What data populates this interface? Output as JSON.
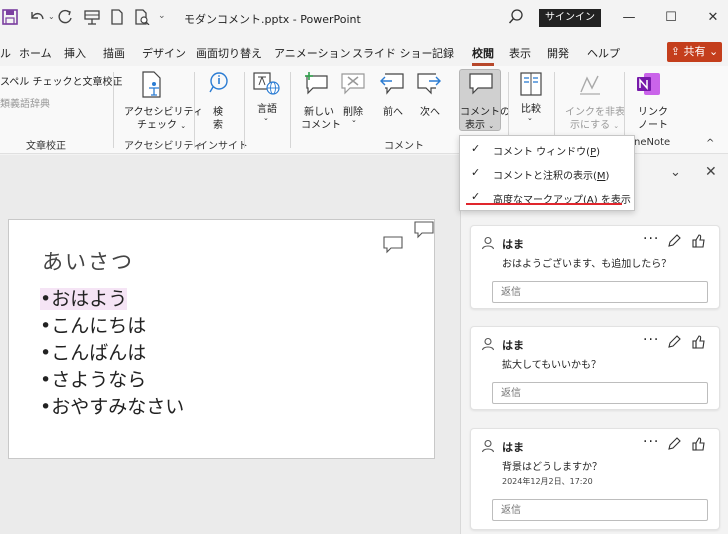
{
  "titlebar": {
    "title": "モダンコメント.pptx  -  PowerPoint",
    "signin_label": "サインイン",
    "minimize": "—",
    "maximize": "☐",
    "close": "✕",
    "undo_arrow": "⌄",
    "more": "⌄"
  },
  "tabs": [
    {
      "label": "ル"
    },
    {
      "label": "ホーム"
    },
    {
      "label": "挿入"
    },
    {
      "label": "描画"
    },
    {
      "label": "デザイン"
    },
    {
      "label": "画面切り替え"
    },
    {
      "label": "アニメーション"
    },
    {
      "label": "スライド ショー"
    },
    {
      "label": "記録"
    },
    {
      "label": "校閲"
    },
    {
      "label": "表示"
    },
    {
      "label": "開発"
    },
    {
      "label": "ヘルプ"
    }
  ],
  "share_label": "共有",
  "ribbon": {
    "spell_label": "スペル チェックと文章校正",
    "thesaurus_label": "類義語辞典",
    "group_proofing": "文章校正",
    "accessibility_label1": "アクセシビリティ",
    "accessibility_label2": "チェック",
    "group_accessibility": "アクセシビリティ",
    "search_label1": "検",
    "search_label2": "索",
    "group_insights": "インサイト",
    "language_label": "言語",
    "new_comment1": "新しい",
    "new_comment2": "コメント",
    "delete_label": "削除",
    "prev_label": "前へ",
    "next_label": "次へ",
    "group_comments": "コメント",
    "show_comments1": "コメントの",
    "show_comments2": "表示",
    "compare_label": "比較",
    "hide_ink1": "インクを非表",
    "hide_ink2": "示にする",
    "link_note1": "リンク",
    "link_note2": "ノート",
    "group_onenote": "neNote",
    "collapse": "^"
  },
  "menu": {
    "items": [
      {
        "check": "✓",
        "label": "コメント ウィンドウ(",
        "key": "P",
        "suffix": ")"
      },
      {
        "check": "✓",
        "label": "コメントと注釈の表示(",
        "key": "M",
        "suffix": ")"
      },
      {
        "check": "✓",
        "label": "高度なマークアップ(",
        "key": "A",
        "suffix": ") を表示"
      }
    ]
  },
  "slide": {
    "title": "あいさつ",
    "bullets": [
      "•おはよう",
      "•こんにちは",
      "•こんばんは",
      "•さようなら",
      "•おやすみなさい"
    ]
  },
  "pane": {
    "chevron": "⌄",
    "close": "✕",
    "comments": [
      {
        "author": "はま",
        "text": "おはようございます、も追加したら？",
        "date": "",
        "reply_placeholder": "返信"
      },
      {
        "author": "はま",
        "text": "拡大してもいいかも？",
        "date": "",
        "reply_placeholder": "返信"
      },
      {
        "author": "はま",
        "text": "背景はどうしますか？",
        "date": "2024年12月2日、17:20",
        "reply_placeholder": "返信"
      }
    ],
    "more": "···"
  },
  "colors": {
    "accent": "#b7472a",
    "share": "#c43e1c",
    "menu_underline": "#e0262d",
    "highlight": "#f5e4f5"
  }
}
